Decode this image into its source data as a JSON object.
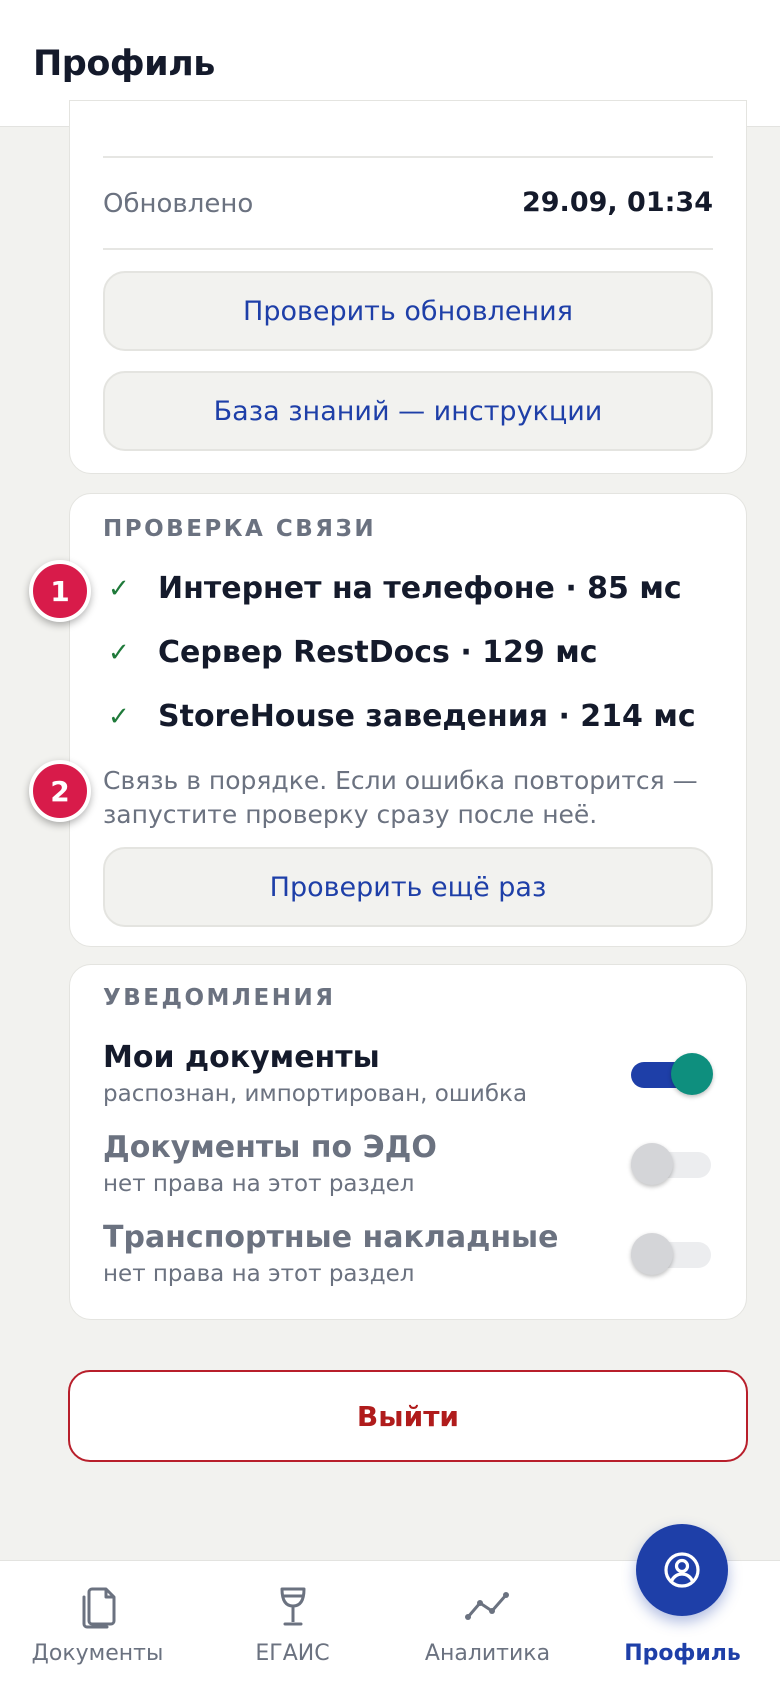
{
  "header": {
    "title": "Профиль"
  },
  "app_info": {
    "updated_label": "Обновлено",
    "updated_value": "29.09, 01:34",
    "check_updates_label": "Проверить обновления",
    "knowledge_base_label": "База знаний — инструкции"
  },
  "connection": {
    "title": "ПРОВЕРКА СВЯЗИ",
    "checks": [
      {
        "icon": "check-icon",
        "label": "Интернет на телефоне · 85 мс"
      },
      {
        "icon": "check-icon",
        "label": "Сервер RestDocs · 129 мс"
      },
      {
        "icon": "check-icon",
        "label": "StoreHouse заведения · 214 мс"
      }
    ],
    "note": "Связь в порядке. Если ошибка повторится — запустите проверку сразу после неё.",
    "recheck_label": "Проверить ещё раз"
  },
  "notifications": {
    "title": "УВЕДОМЛЕНИЯ",
    "items": [
      {
        "title": "Мои документы",
        "subtitle": "распознан, импортирован, ошибка",
        "enabled": true
      },
      {
        "title": "Документы по ЭДО",
        "subtitle": "нет права на этот раздел",
        "enabled": false
      },
      {
        "title": "Транспортные накладные",
        "subtitle": "нет права на этот раздел",
        "enabled": false
      }
    ]
  },
  "logout_label": "Выйти",
  "markers": [
    "1",
    "2"
  ],
  "bottom_nav": {
    "items": [
      {
        "label": "Документы",
        "icon": "documents-icon"
      },
      {
        "label": "ЕГАИС",
        "icon": "wine-glass-icon"
      },
      {
        "label": "Аналитика",
        "icon": "analytics-icon"
      },
      {
        "label": "Профиль",
        "icon": "profile-icon",
        "active": true
      }
    ]
  },
  "colors": {
    "accent": "#1e3fa8",
    "success": "#1f7a3a",
    "danger": "#b01c1c",
    "marker": "#d81b4a",
    "toggle_on_knob": "#0e8f7e"
  }
}
